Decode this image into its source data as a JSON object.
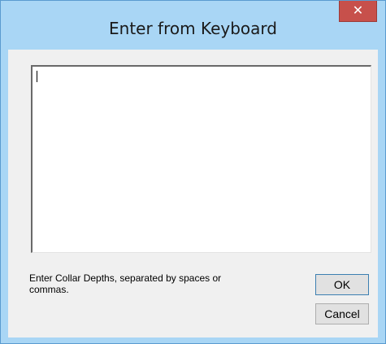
{
  "window": {
    "title": "Enter from Keyboard",
    "close_glyph": "✕"
  },
  "input": {
    "value": ""
  },
  "instructions": "Enter Collar Depths, separated by spaces or\ncommas.",
  "buttons": {
    "ok_label": "OK",
    "cancel_label": "Cancel"
  },
  "colors": {
    "frame": "#a9d6f5",
    "close_button": "#c7504b",
    "client": "#f0f0f0"
  }
}
